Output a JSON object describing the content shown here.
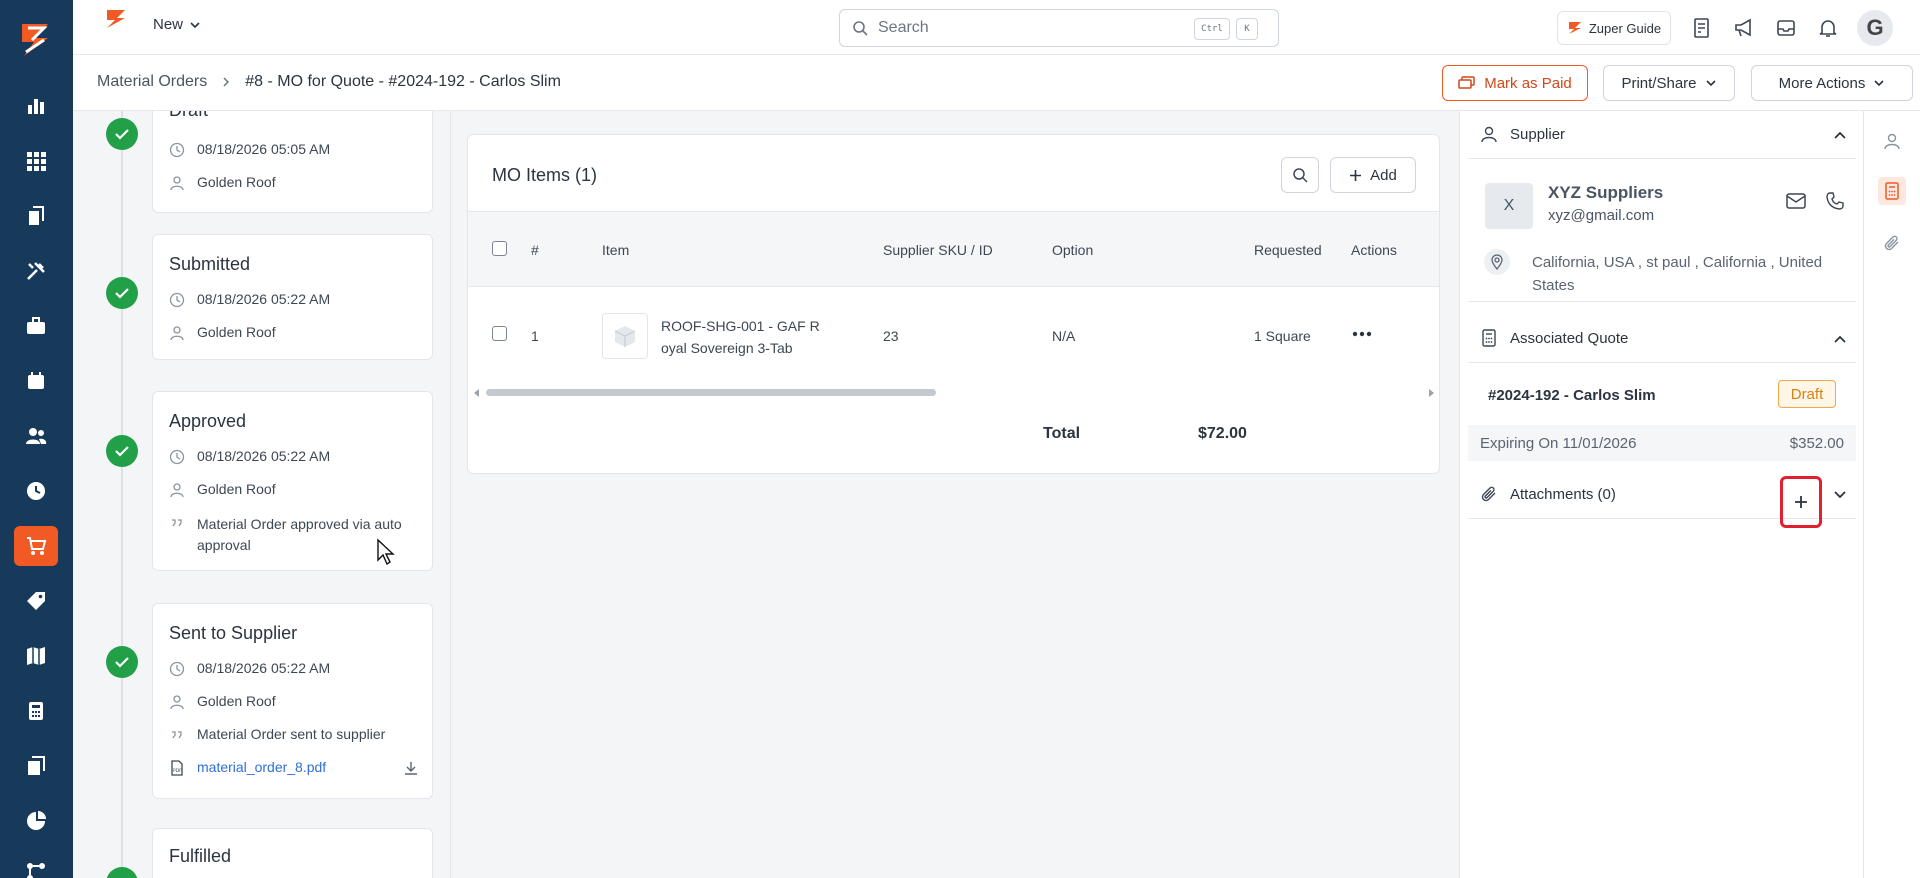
{
  "topbar": {
    "new_label": "New",
    "search_placeholder": "Search",
    "kbd_ctrl": "Ctrl",
    "kbd_k": "K",
    "guide_label": "Zuper Guide",
    "avatar_letter": "G"
  },
  "breadcrumb": {
    "parent": "Material Orders",
    "current": "#8 - MO for Quote - #2024-192 - Carlos Slim"
  },
  "actions": {
    "mark_paid": "Mark as Paid",
    "print_share": "Print/Share",
    "more_actions": "More Actions"
  },
  "timeline": {
    "cards": [
      {
        "title": "Draft",
        "date": "08/18/2026 05:05 AM",
        "user": "Golden Roof"
      },
      {
        "title": "Submitted",
        "date": "08/18/2026 05:22 AM",
        "user": "Golden Roof"
      },
      {
        "title": "Approved",
        "date": "08/18/2026 05:22 AM",
        "user": "Golden Roof",
        "note": "Material Order approved via auto approval"
      },
      {
        "title": "Sent to Supplier",
        "date": "08/18/2026 05:22 AM",
        "user": "Golden Roof",
        "note": "Material Order sent to supplier",
        "file": "material_order_8.pdf"
      },
      {
        "title": "Fulfilled"
      }
    ]
  },
  "mo_items": {
    "title": "MO Items (1)",
    "add_label": "Add",
    "columns": {
      "num": "#",
      "item": "Item",
      "sku": "Supplier SKU / ID",
      "option": "Option",
      "requested": "Requested",
      "actions": "Actions"
    },
    "rows": [
      {
        "num": "1",
        "item_line1": "ROOF-SHG-001 - GAF R",
        "item_line2": "oyal Sovereign 3-Tab",
        "sku": "23",
        "option": "N/A",
        "requested": "1 Square"
      }
    ],
    "total_label": "Total",
    "total_value": "$72.00"
  },
  "supplier": {
    "section_title": "Supplier",
    "avatar_letter": "X",
    "name": "XYZ Suppliers",
    "email": "xyz@gmail.com",
    "address_line1": "California, USA , st paul , California , United",
    "address_line2": "States"
  },
  "quote": {
    "section_title": "Associated Quote",
    "id": "#2024-192 - Carlos Slim",
    "status": "Draft",
    "expiring": "Expiring On 11/01/2026",
    "amount": "$352.00"
  },
  "attachments": {
    "section_title": "Attachments (0)"
  },
  "colors": {
    "nav_bg": "#173a5a",
    "accent": "#f15a24",
    "success": "#22a048",
    "link": "#2f6fd6",
    "draft": "#d98213"
  }
}
